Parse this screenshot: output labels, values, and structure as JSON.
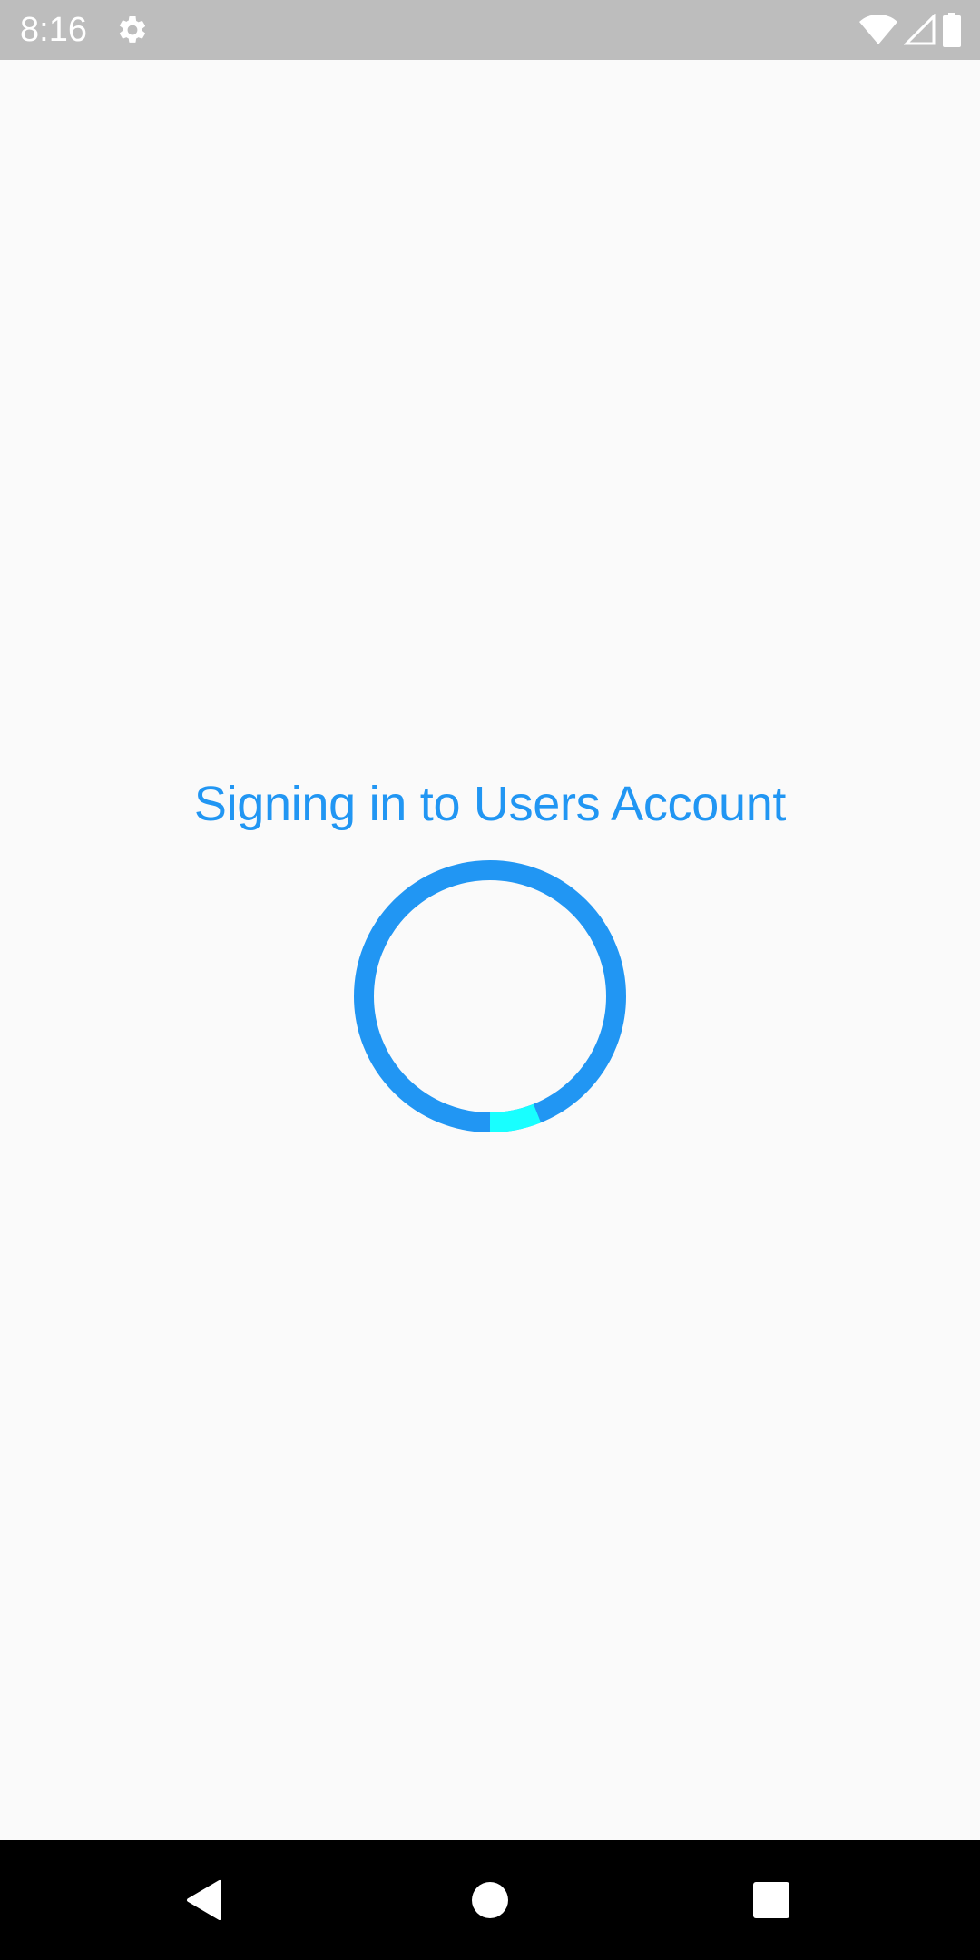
{
  "status_bar": {
    "time": "8:16",
    "icons": [
      "gear-icon",
      "wifi-icon",
      "signal-icon",
      "battery-icon"
    ],
    "background": "#bdbdbd"
  },
  "main": {
    "title": "Signing in to Users Account",
    "title_color": "#2196f3",
    "spinner": {
      "ring_color": "#2196f3",
      "highlight_color": "#18ffff"
    }
  },
  "nav_bar": {
    "buttons": [
      "back-icon",
      "home-icon",
      "recents-icon"
    ],
    "background": "#000000"
  }
}
